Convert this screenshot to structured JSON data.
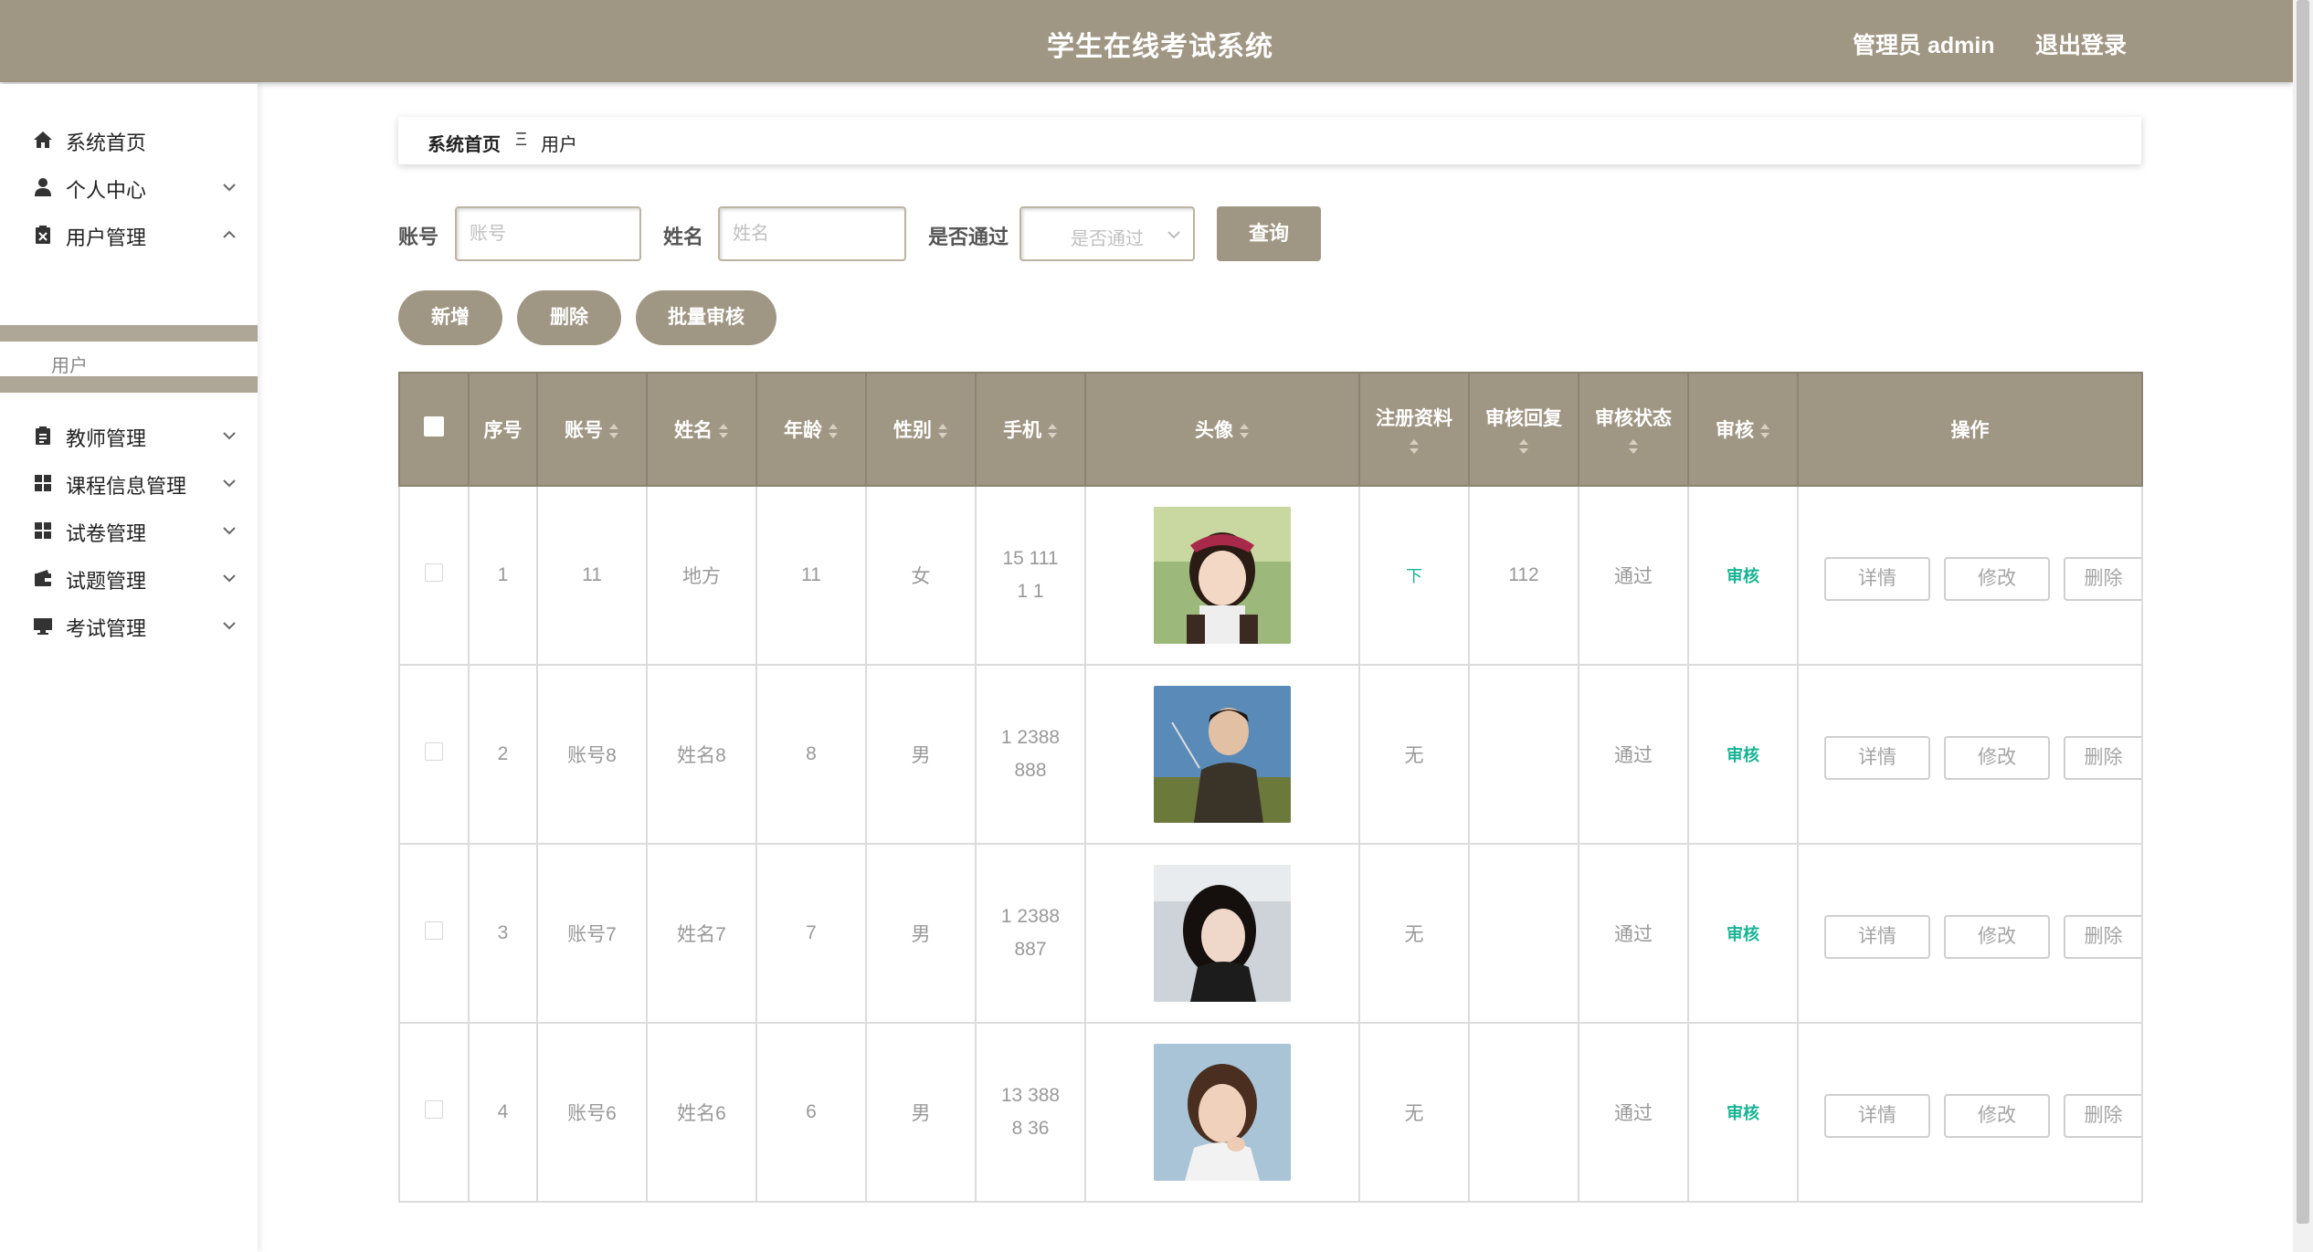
{
  "header": {
    "title": "学生在线考试系统",
    "user_label": "管理员 admin",
    "logout_label": "退出登录"
  },
  "sidebar": {
    "items": [
      {
        "label": "系统首页",
        "icon": "home-icon"
      },
      {
        "label": "个人中心",
        "icon": "person-icon"
      },
      {
        "label": "用户管理",
        "icon": "clipboard-icon"
      },
      {
        "label": "教师管理",
        "icon": "clipboard-list-icon"
      },
      {
        "label": "课程信息管理",
        "icon": "grid-icon"
      },
      {
        "label": "试卷管理",
        "icon": "grid-icon"
      },
      {
        "label": "试题管理",
        "icon": "wallet-icon"
      },
      {
        "label": "考试管理",
        "icon": "monitor-icon"
      }
    ],
    "sub_item": "用户"
  },
  "breadcrumb": {
    "home": "系统首页",
    "separator": "Ξ",
    "current": "用户"
  },
  "search": {
    "account_label": "账号",
    "account_placeholder": "账号",
    "name_label": "姓名",
    "name_placeholder": "姓名",
    "passed_label": "是否通过",
    "passed_placeholder": "是否通过",
    "query_button": "查询"
  },
  "actions": {
    "add": "新增",
    "delete": "删除",
    "batch_audit": "批量审核"
  },
  "table": {
    "headers": {
      "index": "序号",
      "account": "账号",
      "name": "姓名",
      "age": "年龄",
      "gender": "性别",
      "phone": "手机",
      "avatar": "头像",
      "reg_docs": "注册资料",
      "audit_reply": "审核回复",
      "audit_status": "审核状态",
      "audit": "审核",
      "ops": "操作"
    },
    "rows": [
      {
        "index": "1",
        "account": "11",
        "name": "地方",
        "age": "11",
        "gender": "女",
        "phone_line1": "15 111",
        "phone_line2": "1 1",
        "reg_docs": "下",
        "audit_reply": "112",
        "audit_status": "通过",
        "audit": "审核",
        "avatar": "avatar-girl-red-beret"
      },
      {
        "index": "2",
        "account": "账号8",
        "name": "姓名8",
        "age": "8",
        "gender": "男",
        "phone_line1": "1 2388",
        "phone_line2": "888",
        "reg_docs": "无",
        "audit_reply": "",
        "audit_status": "通过",
        "audit": "审核",
        "avatar": "avatar-man-field"
      },
      {
        "index": "3",
        "account": "账号7",
        "name": "姓名7",
        "age": "7",
        "gender": "男",
        "phone_line1": "1 2388",
        "phone_line2": "887",
        "reg_docs": "无",
        "audit_reply": "",
        "audit_status": "通过",
        "audit": "审核",
        "avatar": "avatar-girl-car"
      },
      {
        "index": "4",
        "account": "账号6",
        "name": "姓名6",
        "age": "6",
        "gender": "男",
        "phone_line1": "13 388",
        "phone_line2": "8 36",
        "reg_docs": "无",
        "audit_reply": "",
        "audit_status": "通过",
        "audit": "审核",
        "avatar": "avatar-boy-portrait"
      }
    ],
    "row_buttons": {
      "detail": "详情",
      "edit": "修改",
      "delete": "删除"
    }
  },
  "colors": {
    "theme": "#a09684",
    "link": "#19b394"
  }
}
